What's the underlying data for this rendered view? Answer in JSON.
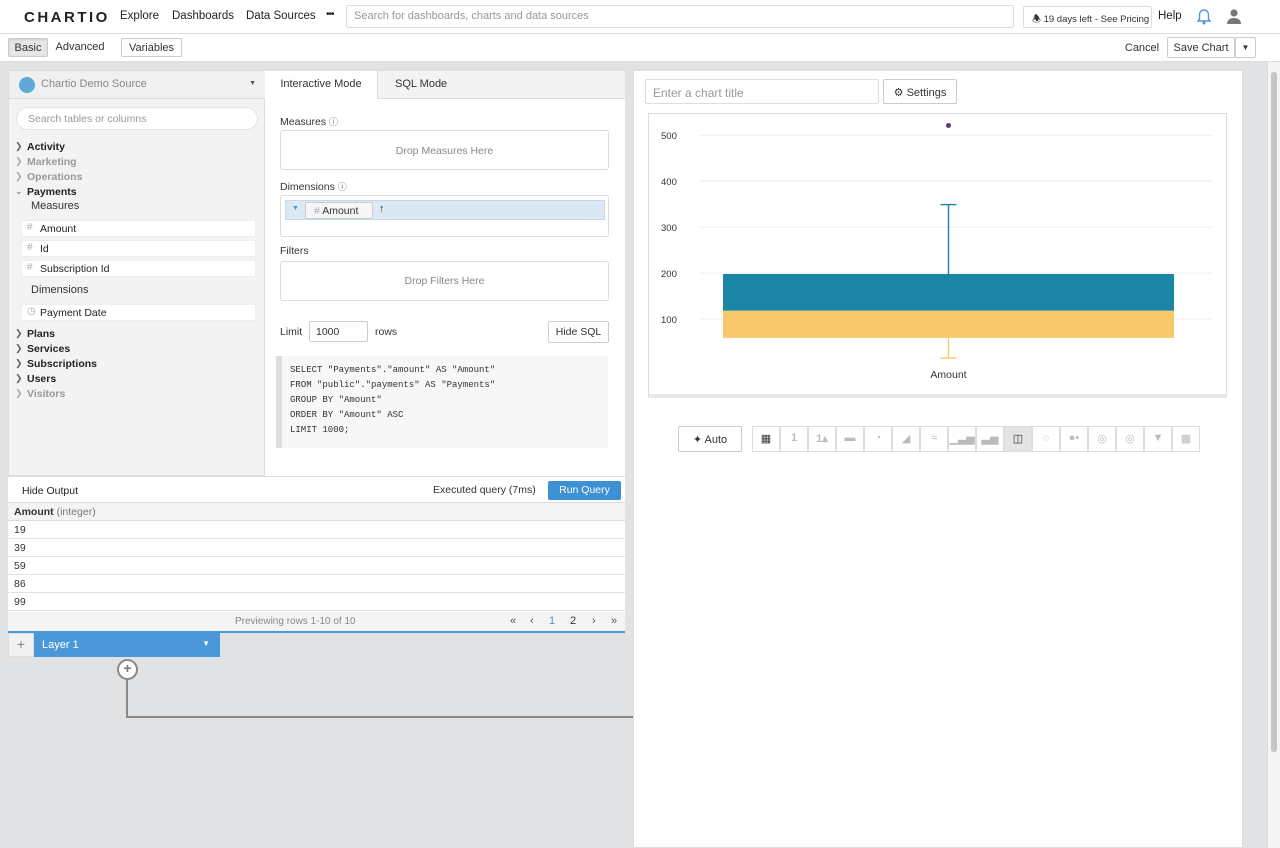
{
  "app": {
    "logo": "CHARTIO"
  },
  "nav": {
    "explore": "Explore",
    "dashboards": "Dashboards",
    "data_sources": "Data Sources",
    "more": "•••"
  },
  "search": {
    "placeholder": "Search for dashboards, charts and data sources"
  },
  "trial": {
    "text": "19 days left - See Pricing"
  },
  "help": "Help",
  "toolbar": {
    "basic": "Basic",
    "advanced": "Advanced",
    "variables": "Variables",
    "cancel": "Cancel",
    "save": "Save Chart"
  },
  "source": {
    "name": "Chartio Demo Source",
    "search_placeholder": "Search tables or columns"
  },
  "tables": [
    {
      "name": "Activity",
      "dim": false
    },
    {
      "name": "Marketing",
      "dim": true
    },
    {
      "name": "Operations",
      "dim": true
    },
    {
      "name": "Payments",
      "dim": false,
      "expanded": true
    }
  ],
  "payments": {
    "measures_label": "Measures",
    "measures": [
      "Amount",
      "Id",
      "Subscription Id"
    ],
    "dimensions_label": "Dimensions",
    "dimensions": [
      "Payment Date"
    ]
  },
  "tables_after": [
    {
      "name": "Plans",
      "dim": false
    },
    {
      "name": "Services",
      "dim": false
    },
    {
      "name": "Subscriptions",
      "dim": false
    },
    {
      "name": "Users",
      "dim": false
    },
    {
      "name": "Visitors",
      "dim": true
    }
  ],
  "query": {
    "tab_interactive": "Interactive Mode",
    "tab_sql": "SQL Mode",
    "measures_label": "Measures",
    "measures_drop": "Drop Measures Here",
    "dimensions_label": "Dimensions",
    "dimension_pill": "Amount",
    "sort_arrow": "↑",
    "filters_label": "Filters",
    "filters_drop": "Drop Filters Here",
    "limit_label": "Limit",
    "limit_value": "1000",
    "rows_label": "rows",
    "hide_sql": "Hide SQL",
    "sql": "SELECT \"Payments\".\"amount\" AS \"Amount\"\nFROM \"public\".\"payments\" AS \"Payments\"\nGROUP BY \"Amount\"\nORDER BY \"Amount\" ASC\nLIMIT 1000;"
  },
  "output": {
    "hide_output": "Hide Output",
    "status": "Executed query (7ms)",
    "run": "Run Query",
    "column_name": "Amount",
    "column_type": "(integer)",
    "rows": [
      "19",
      "39",
      "59",
      "86",
      "99"
    ],
    "preview": "Previewing rows 1-10 of 10",
    "pager": {
      "first": "«",
      "prev": "‹",
      "p1": "1",
      "p2": "2",
      "next": "›",
      "last": "»"
    }
  },
  "layer": {
    "add": "+",
    "name": "Layer 1",
    "caret": "▼"
  },
  "chart": {
    "title_placeholder": "Enter a chart title",
    "settings": "Settings",
    "auto": "Auto",
    "colors": {
      "upper_box": "#1b85a6",
      "lower_box": "#f6c869",
      "outlier": "#5a3d73",
      "whisker": "#1b85a6",
      "accent": "#4a98d8"
    }
  },
  "chart_data": {
    "type": "box",
    "categories": [
      "Amount"
    ],
    "ylim": [
      0,
      520
    ],
    "yticks": [
      100,
      200,
      300,
      400,
      500
    ],
    "box": {
      "lower_whisker": 15,
      "q1": 59,
      "median": 118,
      "q3": 198,
      "upper_whisker": 349
    },
    "outliers": [
      521
    ],
    "grid": true
  }
}
